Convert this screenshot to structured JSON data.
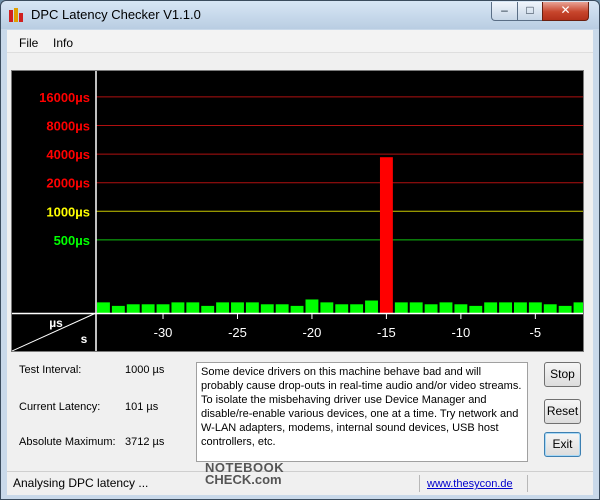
{
  "window": {
    "title": "DPC Latency Checker V1.1.0",
    "min_glyph": "–",
    "max_glyph": "□",
    "close_glyph": "✕"
  },
  "menu": {
    "file": "File",
    "info": "Info"
  },
  "chart_data": {
    "type": "bar",
    "title": "",
    "y_axis_unit_label": "µs",
    "x_axis_unit_label": "s",
    "y_scale": "log",
    "y_levels": [
      {
        "label": "16000µs",
        "value": 16000,
        "color": "#ff0000"
      },
      {
        "label": "8000µs",
        "value": 8000,
        "color": "#ff0000"
      },
      {
        "label": "4000µs",
        "value": 4000,
        "color": "#ff0000"
      },
      {
        "label": "2000µs",
        "value": 2000,
        "color": "#ff0000"
      },
      {
        "label": "1000µs",
        "value": 1000,
        "color": "#ffff00"
      },
      {
        "label": "500µs",
        "value": 500,
        "color": "#00ff00"
      }
    ],
    "x_ticks": [
      {
        "label": "-30",
        "value": -30
      },
      {
        "label": "-25",
        "value": -25
      },
      {
        "label": "-20",
        "value": -20
      },
      {
        "label": "-15",
        "value": -15
      },
      {
        "label": "-10",
        "value": -10
      },
      {
        "label": "-5",
        "value": -5
      }
    ],
    "x_range": [
      -34,
      -1.3
    ],
    "y_range": [
      85,
      30000
    ],
    "bar_width_s": 1,
    "bars": [
      {
        "x": -34,
        "y": 110
      },
      {
        "x": -33,
        "y": 101
      },
      {
        "x": -32,
        "y": 105
      },
      {
        "x": -31,
        "y": 105
      },
      {
        "x": -30,
        "y": 105
      },
      {
        "x": -29,
        "y": 110
      },
      {
        "x": -28,
        "y": 110
      },
      {
        "x": -27,
        "y": 101
      },
      {
        "x": -26,
        "y": 110
      },
      {
        "x": -25,
        "y": 110
      },
      {
        "x": -24,
        "y": 110
      },
      {
        "x": -23,
        "y": 105
      },
      {
        "x": -22,
        "y": 105
      },
      {
        "x": -21,
        "y": 101
      },
      {
        "x": -20,
        "y": 118
      },
      {
        "x": -19,
        "y": 110
      },
      {
        "x": -18,
        "y": 105
      },
      {
        "x": -17,
        "y": 105
      },
      {
        "x": -16,
        "y": 115
      },
      {
        "x": -15,
        "y": 3712
      },
      {
        "x": -14,
        "y": 110
      },
      {
        "x": -13,
        "y": 110
      },
      {
        "x": -12,
        "y": 105
      },
      {
        "x": -11,
        "y": 110
      },
      {
        "x": -10,
        "y": 105
      },
      {
        "x": -9,
        "y": 101
      },
      {
        "x": -8,
        "y": 110
      },
      {
        "x": -7,
        "y": 110
      },
      {
        "x": -6,
        "y": 110
      },
      {
        "x": -5,
        "y": 110
      },
      {
        "x": -4,
        "y": 105
      },
      {
        "x": -3,
        "y": 101
      },
      {
        "x": -2,
        "y": 110
      }
    ],
    "bar_colors": {
      "normal": "#00ff00",
      "over_limit": "#ff0000"
    },
    "limit_value": 1000
  },
  "stats": {
    "test_interval_label": "Test Interval:",
    "test_interval_value": "1000 µs",
    "current_latency_label": "Current Latency:",
    "current_latency_value": "101 µs",
    "absolute_maximum_label": "Absolute Maximum:",
    "absolute_maximum_value": "3712 µs"
  },
  "description": "Some device drivers on this machine behave bad and will probably cause drop-outs in real-time audio and/or video streams. To isolate the misbehaving driver use Device Manager and disable/re-enable various devices, one at a time. Try network and W-LAN adapters, modems, internal sound devices, USB host controllers, etc.",
  "buttons": {
    "stop": "Stop",
    "reset": "Reset",
    "exit": "Exit"
  },
  "status": {
    "message": "Analysing DPC latency ...",
    "link": "www.thesycon.de"
  },
  "watermark": {
    "line1": "NOTEBOOK",
    "line2": "CHECK.com"
  }
}
